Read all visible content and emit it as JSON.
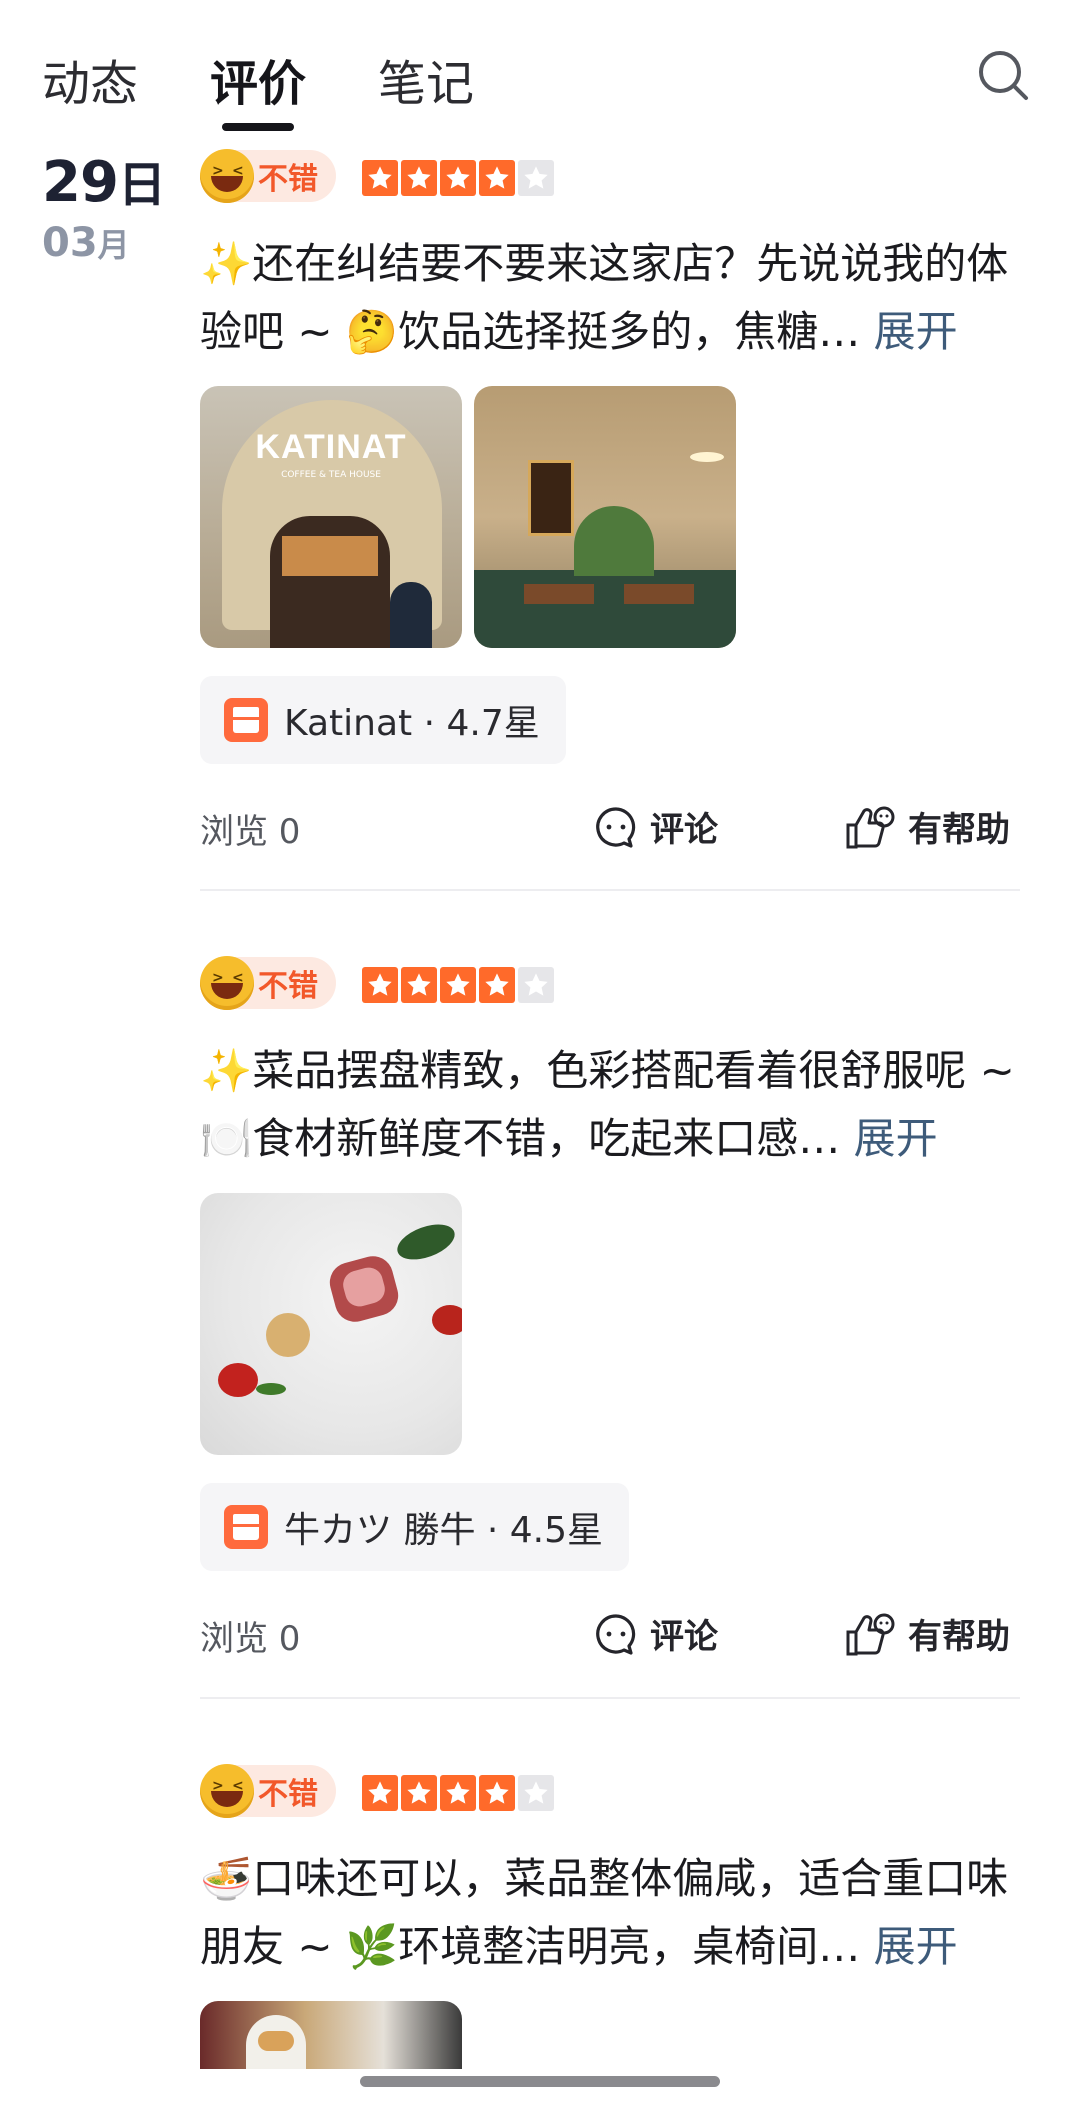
{
  "tabs": [
    {
      "label": "动态",
      "active": false
    },
    {
      "label": "评价",
      "active": true
    },
    {
      "label": "笔记",
      "active": false
    }
  ],
  "date": {
    "day": "29",
    "day_suffix": "日",
    "month": "03",
    "month_suffix": "月"
  },
  "reviews": [
    {
      "badge": "不错",
      "stars": 4,
      "text": "✨还在纠结要不要来这家店？先说说我的体验吧 ~ 🤔饮品选择挺多的，焦糖…",
      "expand": "展开",
      "photo_sign": "KATINAT",
      "photo_sign_sub": "COFFEE & TEA HOUSE",
      "shop": "Katinat · 4.7星",
      "views": "浏览 0",
      "comment": "评论",
      "helpful": "有帮助"
    },
    {
      "badge": "不错",
      "stars": 4,
      "text": "✨菜品摆盘精致，色彩搭配看着很舒服呢 ~ 🍽️食材新鲜度不错，吃起来口感…",
      "expand": "展开",
      "shop": "牛カツ 勝牛 · 4.5星",
      "views": "浏览 0",
      "comment": "评论",
      "helpful": "有帮助"
    },
    {
      "badge": "不错",
      "stars": 4,
      "text": "🍜口味还可以，菜品整体偏咸，适合重口味朋友 ~ 🌿环境整洁明亮，桌椅间…",
      "expand": "展开"
    }
  ],
  "colors": {
    "accent": "#ff6a2a",
    "badge_bg": "#fde9e1",
    "expand": "#3e5b7a"
  }
}
